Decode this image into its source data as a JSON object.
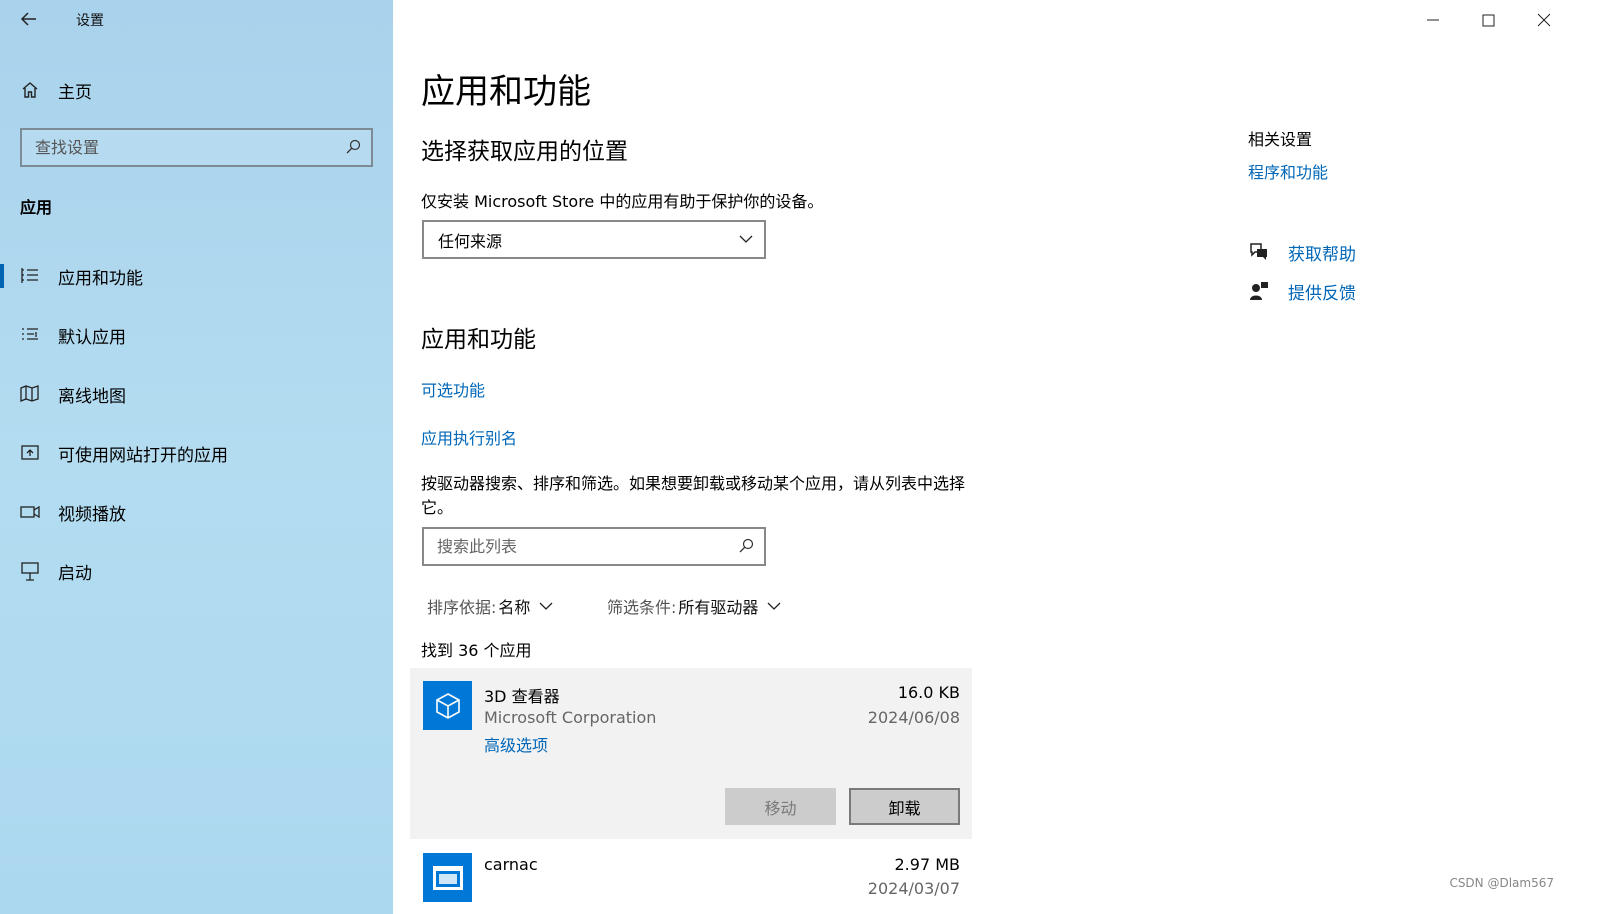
{
  "window": {
    "title": "设置",
    "back_icon": "back-arrow-icon",
    "controls": [
      "minimize-icon",
      "maximize-icon",
      "close-icon"
    ]
  },
  "sidebar": {
    "home_label": "主页",
    "search_placeholder": "查找设置",
    "section_label": "应用",
    "items": [
      {
        "label": "应用和功能",
        "icon": "apps-features-icon",
        "selected": true
      },
      {
        "label": "默认应用",
        "icon": "default-apps-icon",
        "selected": false
      },
      {
        "label": "离线地图",
        "icon": "offline-maps-icon",
        "selected": false
      },
      {
        "label": "可使用网站打开的应用",
        "icon": "apps-for-websites-icon",
        "selected": false
      },
      {
        "label": "视频播放",
        "icon": "video-playback-icon",
        "selected": false
      },
      {
        "label": "启动",
        "icon": "startup-icon",
        "selected": false
      }
    ]
  },
  "main": {
    "title": "应用和功能",
    "source_heading": "选择获取应用的位置",
    "source_desc": "仅安装 Microsoft Store 中的应用有助于保护你的设备。",
    "source_value": "任何来源",
    "apps_heading": "应用和功能",
    "optional_features_link": "可选功能",
    "aliases_link": "应用执行别名",
    "list_desc": "按驱动器搜索、排序和筛选。如果想要卸载或移动某个应用，请从列表中选择它。",
    "list_search_placeholder": "搜索此列表",
    "sort_key": "排序依据:",
    "sort_value": "名称",
    "filter_key": "筛选条件:",
    "filter_value": "所有驱动器",
    "found_text": "找到 36 个应用",
    "apps": [
      {
        "name": "3D 查看器",
        "publisher": "Microsoft Corporation",
        "advanced_link": "高级选项",
        "size": "16.0 KB",
        "date": "2024/06/08",
        "move_label": "移动",
        "uninstall_label": "卸载"
      },
      {
        "name": "carnac",
        "size": "2.97 MB",
        "date": "2024/03/07"
      }
    ]
  },
  "related": {
    "title": "相关设置",
    "programs_link": "程序和功能",
    "help_label": "获取帮助",
    "feedback_label": "提供反馈"
  },
  "watermark": "CSDN @Dlam567",
  "colors": {
    "accent": "#0078d7",
    "link": "#0067b8",
    "sidebar": "#acd8ef"
  }
}
